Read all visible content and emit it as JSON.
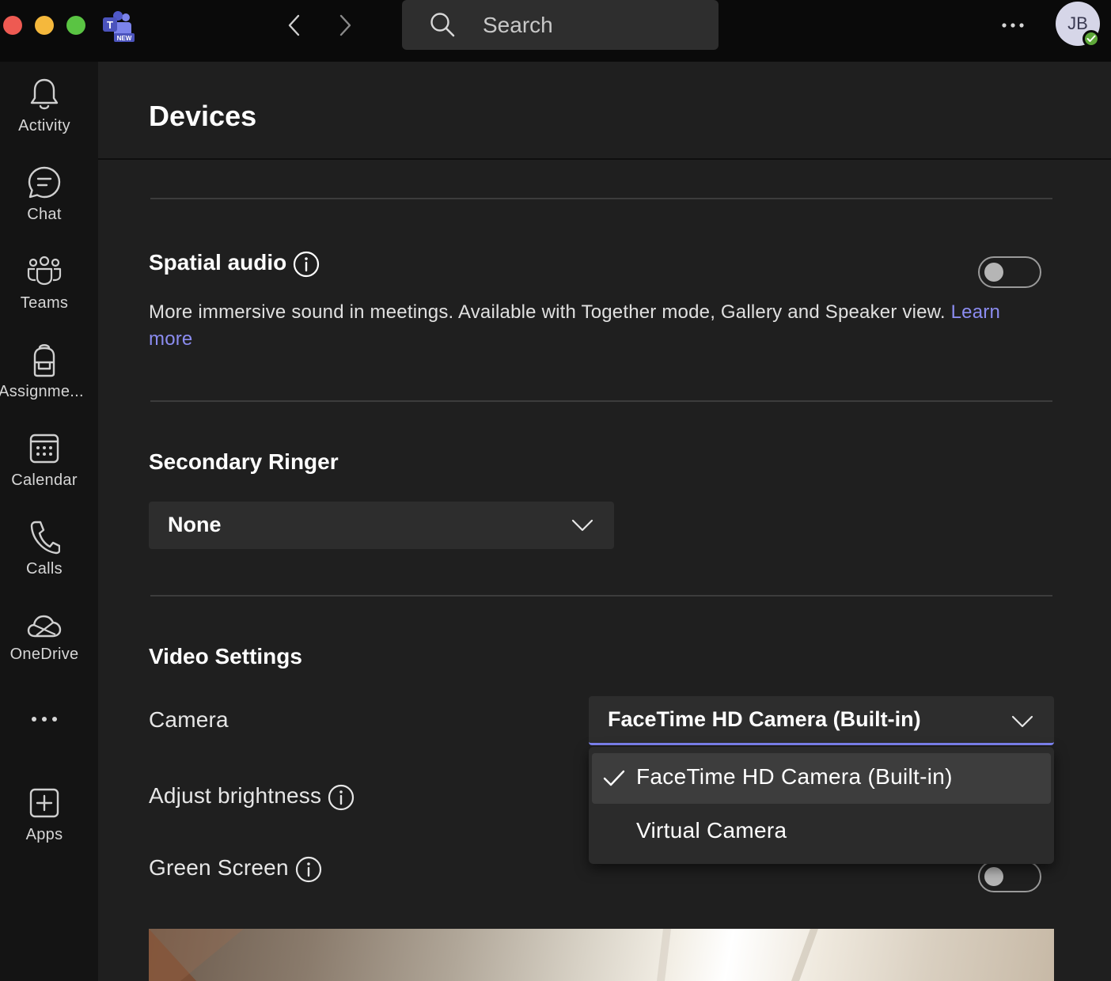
{
  "titlebar": {
    "app_logo_badge": "NEW",
    "search": {
      "placeholder": "Search"
    },
    "avatar": {
      "initials": "JB",
      "presence": "available"
    }
  },
  "rail": {
    "items": [
      {
        "label": "Activity",
        "icon": "bell-icon"
      },
      {
        "label": "Chat",
        "icon": "chat-icon"
      },
      {
        "label": "Teams",
        "icon": "teams-icon"
      },
      {
        "label": "Assignme...",
        "icon": "backpack-icon"
      },
      {
        "label": "Calendar",
        "icon": "calendar-icon"
      },
      {
        "label": "Calls",
        "icon": "phone-icon"
      },
      {
        "label": "OneDrive",
        "icon": "cloud-icon"
      },
      {
        "label": "",
        "icon": "more-icon"
      },
      {
        "label": "Apps",
        "icon": "add-app-icon"
      }
    ]
  },
  "page": {
    "title": "Devices",
    "spatial_audio": {
      "heading": "Spatial audio",
      "enabled": false,
      "description": "More immersive sound in meetings. Available with Together mode, Gallery and Speaker view.",
      "learn_more_1": "Learn",
      "learn_more_2": "more"
    },
    "secondary_ringer": {
      "heading": "Secondary Ringer",
      "selected": "None"
    },
    "video_settings": {
      "heading": "Video Settings",
      "camera_label": "Camera",
      "camera_selected": "FaceTime HD Camera (Built-in)",
      "camera_options": [
        {
          "label": "FaceTime HD Camera (Built-in)",
          "selected": true
        },
        {
          "label": "Virtual Camera",
          "selected": false
        }
      ],
      "brightness_label": "Adjust brightness",
      "green_screen_label": "Green Screen",
      "green_screen_enabled": false
    }
  },
  "colors": {
    "accent": "#7f85f5",
    "link": "#8b8cf0",
    "background": "#1f1f1f",
    "rail": "#141414",
    "titlebar": "#0a0a0a"
  }
}
